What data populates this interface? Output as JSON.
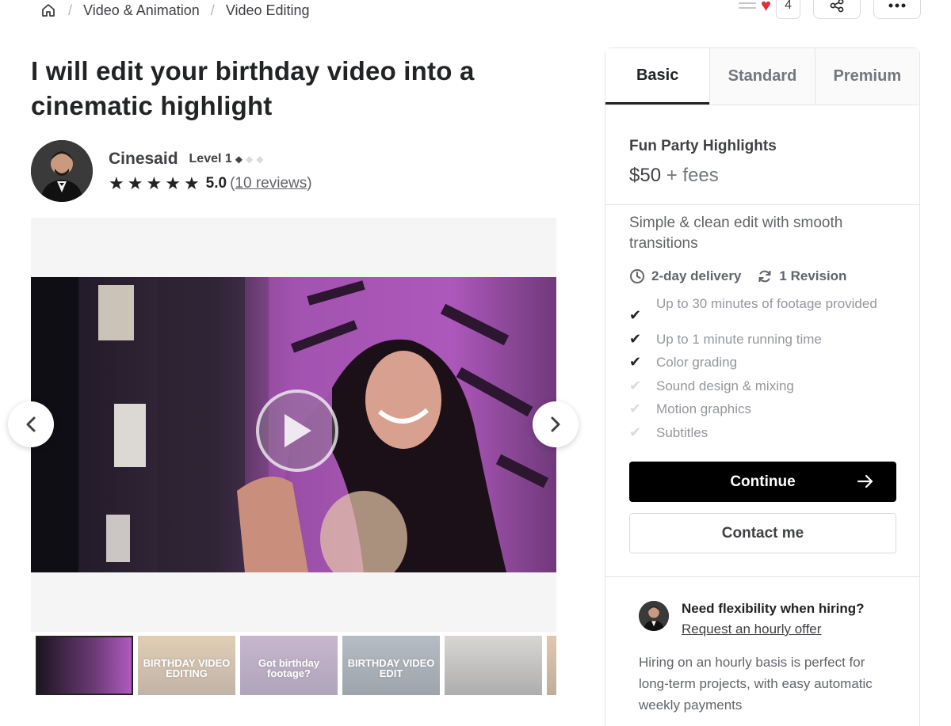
{
  "breadcrumb": {
    "home_icon": "home-icon",
    "items": [
      "Video & Animation",
      "Video Editing"
    ]
  },
  "top_actions": {
    "collection_icon": "list-icon",
    "heart_icon": "heart-icon",
    "likes_count": "4",
    "share_icon": "share-icon",
    "more_icon": "more-icon"
  },
  "gig": {
    "title": "I will edit your birthday video into a cinematic highlight"
  },
  "seller": {
    "name": "Cinesaid",
    "level": "Level 1",
    "level_diamonds_filled": 1,
    "level_diamonds_total": 3,
    "stars": 5,
    "rating": "5.0",
    "reviews_open": "(",
    "reviews_label": "10 reviews",
    "reviews_close": ")"
  },
  "gallery": {
    "thumbnails": [
      {
        "text": ""
      },
      {
        "text": "BIRTHDAY VIDEO EDITING"
      },
      {
        "text": "Got birthday footage?"
      },
      {
        "text": "BIRTHDAY VIDEO EDIT"
      },
      {
        "text": ""
      },
      {
        "text": ""
      }
    ]
  },
  "packages": {
    "tabs": [
      "Basic",
      "Standard",
      "Premium"
    ],
    "selected_tab": "Basic",
    "name": "Fun Party Highlights",
    "price": "$50",
    "fees": " + fees",
    "description": "Simple & clean edit with smooth transitions",
    "delivery": "2-day delivery",
    "revisions": "1 Revision",
    "features": [
      {
        "label": "Up to 30 minutes of footage provided",
        "included": true
      },
      {
        "label": "Up to 1 minute running time",
        "included": true
      },
      {
        "label": "Color grading",
        "included": true
      },
      {
        "label": "Sound design & mixing",
        "included": false
      },
      {
        "label": "Motion graphics",
        "included": false
      },
      {
        "label": "Subtitles",
        "included": false
      }
    ],
    "continue_label": "Continue",
    "contact_label": "Contact me"
  },
  "flexibility": {
    "title": "Need flexibility when hiring?",
    "link": "Request an hourly offer",
    "text": "Hiring on an hourly basis is perfect for long-term projects, with easy automatic weekly payments"
  },
  "colors": {
    "heart": "#e0303b",
    "accent_dark": "#222325",
    "button_black": "#000000"
  }
}
